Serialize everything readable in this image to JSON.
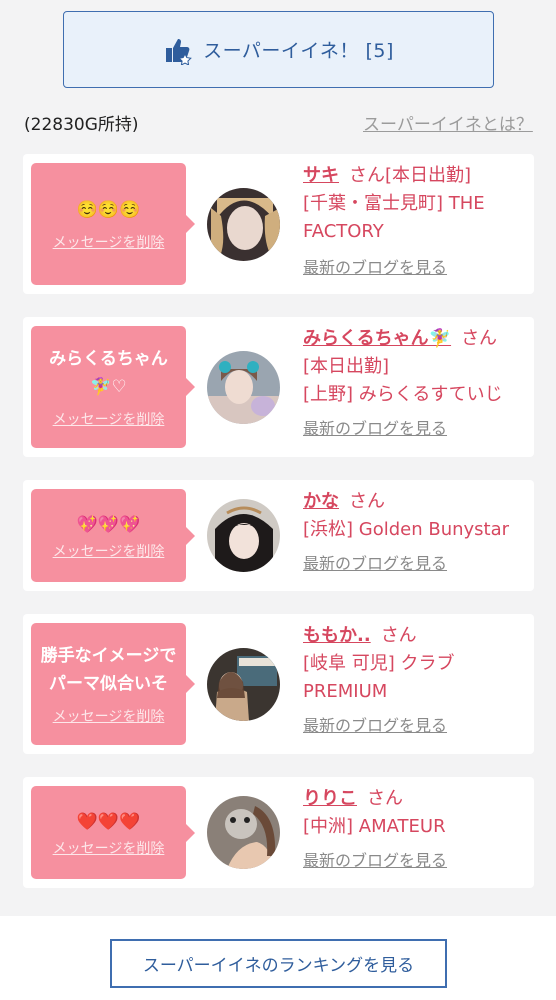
{
  "header": {
    "super_like_label": "スーパーイイネ！ [5]",
    "gold_text": "(22830G所持)",
    "about_link": "スーパーイイネとは？"
  },
  "messages": [
    {
      "message": "☺️☺️☺️",
      "delete_label": "メッセージを削除",
      "name": "サキ",
      "san": "さん",
      "lines": [
        "[本日出勤]",
        "[千葉・富士見町] THE FACTORY"
      ],
      "blog_label": "最新のブログを見る"
    },
    {
      "message": "みらくるちゃん🧚‍♀️♡",
      "delete_label": "メッセージを削除",
      "name": "みらくるちゃん🧚‍♀️",
      "san": "さん",
      "lines": [
        "[本日出勤]",
        "[上野] みらくるすていじ"
      ],
      "blog_label": "最新のブログを見る"
    },
    {
      "message": "💖💖💖",
      "delete_label": "メッセージを削除",
      "name": "かな",
      "san": "さん",
      "lines": [
        "[浜松] Golden Bunystar"
      ],
      "blog_label": "最新のブログを見る"
    },
    {
      "message": "勝手なイメージでパーマ似合いそ",
      "delete_label": "メッセージを削除",
      "name": "ももか..",
      "san": "さん",
      "lines": [
        "[岐阜 可児] クラブ PREMIUM"
      ],
      "blog_label": "最新のブログを見る"
    },
    {
      "message": "❤️❤️❤️",
      "delete_label": "メッセージを削除",
      "name": "りりこ",
      "san": "さん",
      "lines": [
        "[中洲] AMATEUR"
      ],
      "blog_label": "最新のブログを見る"
    }
  ],
  "footer": {
    "ranking_label": "スーパーイイネのランキングを見る"
  },
  "colors": {
    "accent_blue": "#2f5d9c",
    "pink_bubble": "#f6909f",
    "name_pink": "#d6475f"
  }
}
